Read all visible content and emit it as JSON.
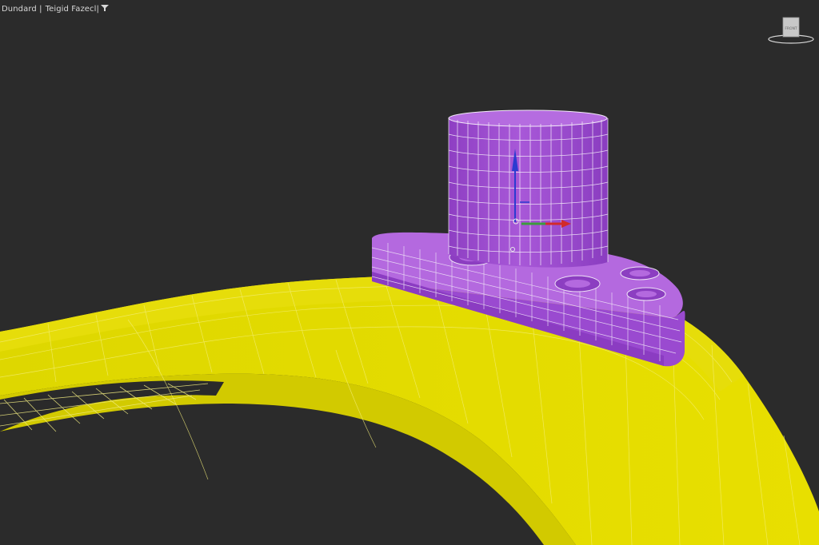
{
  "viewport": {
    "shading_label": "Dundard |",
    "mode_label": "Teigid Fazecl|"
  },
  "viewcube": {
    "face_label": "FRONT"
  },
  "icons": {
    "filter": "filter-icon",
    "gizmo": "move-gizmo-icon"
  },
  "colors": {
    "background": "#2b2b2b",
    "ground_mesh": "#e1d800",
    "selected_object": "#a24fd6",
    "wireframe_line": "#f3eaf8",
    "gizmo_x": "#d22a2a",
    "gizmo_y": "#3c9c3c",
    "gizmo_z": "#2b3bd0"
  }
}
